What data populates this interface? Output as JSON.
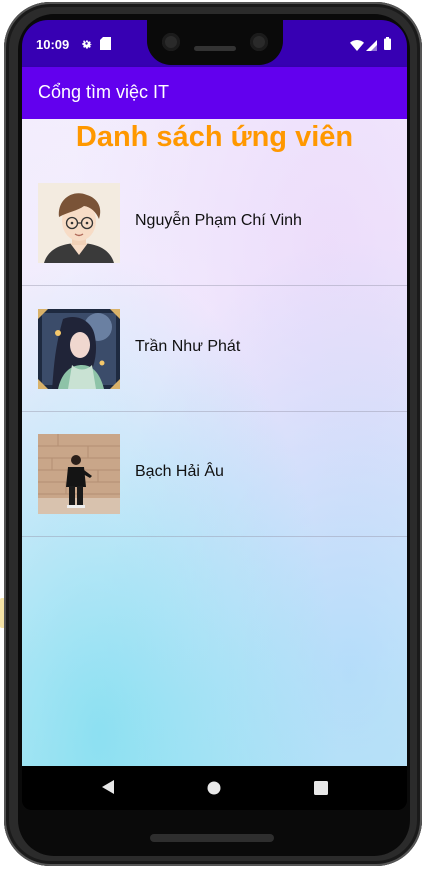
{
  "status_bar": {
    "time": "10:09",
    "left_icons": [
      "gear-icon",
      "sd-card-icon"
    ],
    "right_icons": [
      "wifi-icon",
      "signal-icon",
      "battery-icon"
    ],
    "color": "#3700b3"
  },
  "app_bar": {
    "title": "Cổng tìm việc IT",
    "color": "#6200ee"
  },
  "list": {
    "title": "Danh sách ứng viên",
    "title_color": "#ff9800",
    "candidates": [
      {
        "name": "Nguyễn Phạm Chí Vinh",
        "avatar": "cartoon-portrait-avatar"
      },
      {
        "name": "Trần Như Phát",
        "avatar": "fantasy-character-avatar"
      },
      {
        "name": "Bạch Hải Âu",
        "avatar": "person-by-wall-photo-avatar"
      }
    ]
  },
  "nav_bar": {
    "buttons": [
      "back-icon",
      "home-icon",
      "recents-icon"
    ]
  }
}
